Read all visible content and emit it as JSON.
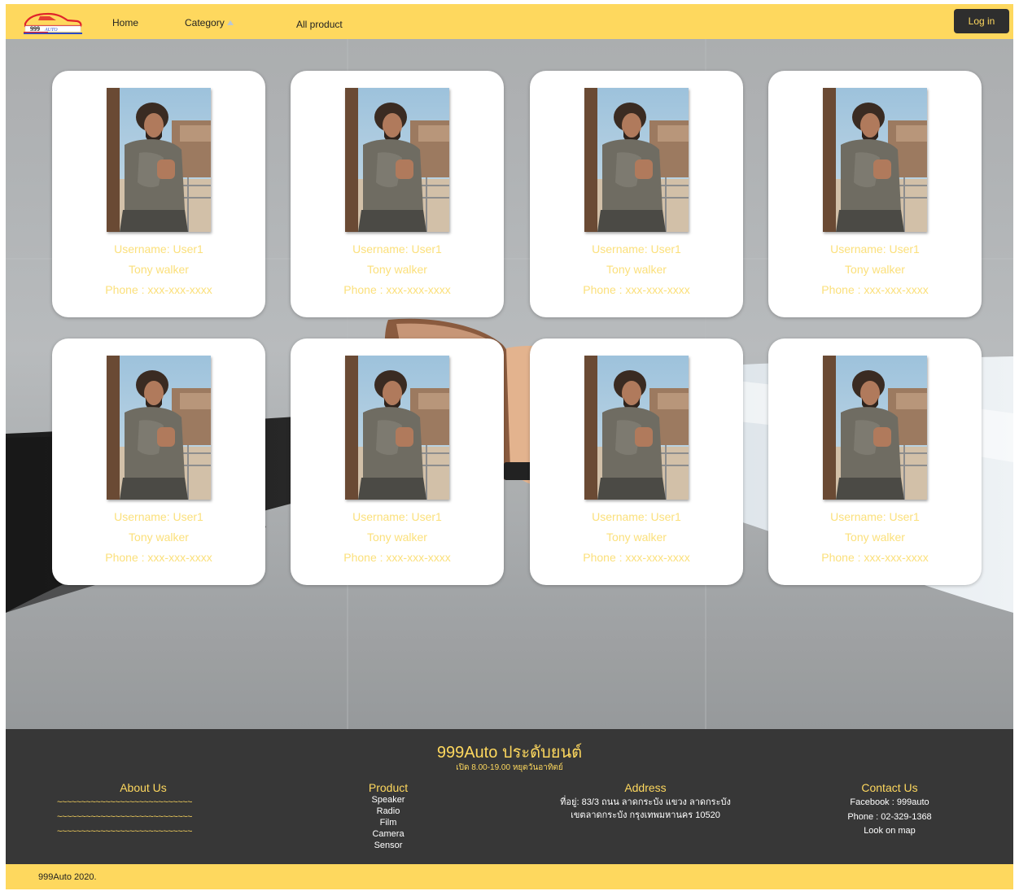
{
  "nav": {
    "logo_text": "999 AUTO",
    "home": "Home",
    "category": "Category",
    "all_product": "All product",
    "login": "Log in"
  },
  "cards": [
    {
      "username": "Username: User1",
      "name": "Tony walker",
      "phone": "Phone : xxx-xxx-xxxx"
    },
    {
      "username": "Username: User1",
      "name": "Tony walker",
      "phone": "Phone : xxx-xxx-xxxx"
    },
    {
      "username": "Username: User1",
      "name": "Tony walker",
      "phone": "Phone : xxx-xxx-xxxx"
    },
    {
      "username": "Username: User1",
      "name": "Tony walker",
      "phone": "Phone : xxx-xxx-xxxx"
    },
    {
      "username": "Username: User1",
      "name": "Tony walker",
      "phone": "Phone : xxx-xxx-xxxx"
    },
    {
      "username": "Username: User1",
      "name": "Tony walker",
      "phone": "Phone : xxx-xxx-xxxx"
    },
    {
      "username": "Username: User1",
      "name": "Tony walker",
      "phone": "Phone : xxx-xxx-xxxx"
    },
    {
      "username": "Username: User1",
      "name": "Tony walker",
      "phone": "Phone : xxx-xxx-xxxx"
    }
  ],
  "footer": {
    "brand": "999Auto ประดับยนต์",
    "hours": "เปิด 8.00-19.00 หยุดวันอาทิตย์",
    "about": {
      "title": "About Us",
      "lines": [
        "~~~~~~~~~~~~~~~~~~~~~~~~~~~~",
        "~~~~~~~~~~~~~~~~~~~~~~~~~~~~",
        "~~~~~~~~~~~~~~~~~~~~~~~~~~~~"
      ]
    },
    "product": {
      "title": "Product",
      "items": [
        "Speaker",
        "Radio",
        "Film",
        "Camera",
        "Sensor"
      ]
    },
    "address": {
      "title": "Address",
      "line1": "ที่อยู่: 83/3 ถนน ลาดกระบัง แขวง ลาดกระบัง",
      "line2": "เขตลาดกระบัง กรุงเทพมหานคร 10520"
    },
    "contact": {
      "title": "Contact Us",
      "facebook": "Facebook : 999auto",
      "phone": "Phone : 02-329-1368",
      "map": "Look on map"
    }
  },
  "copyright": "999Auto 2020."
}
